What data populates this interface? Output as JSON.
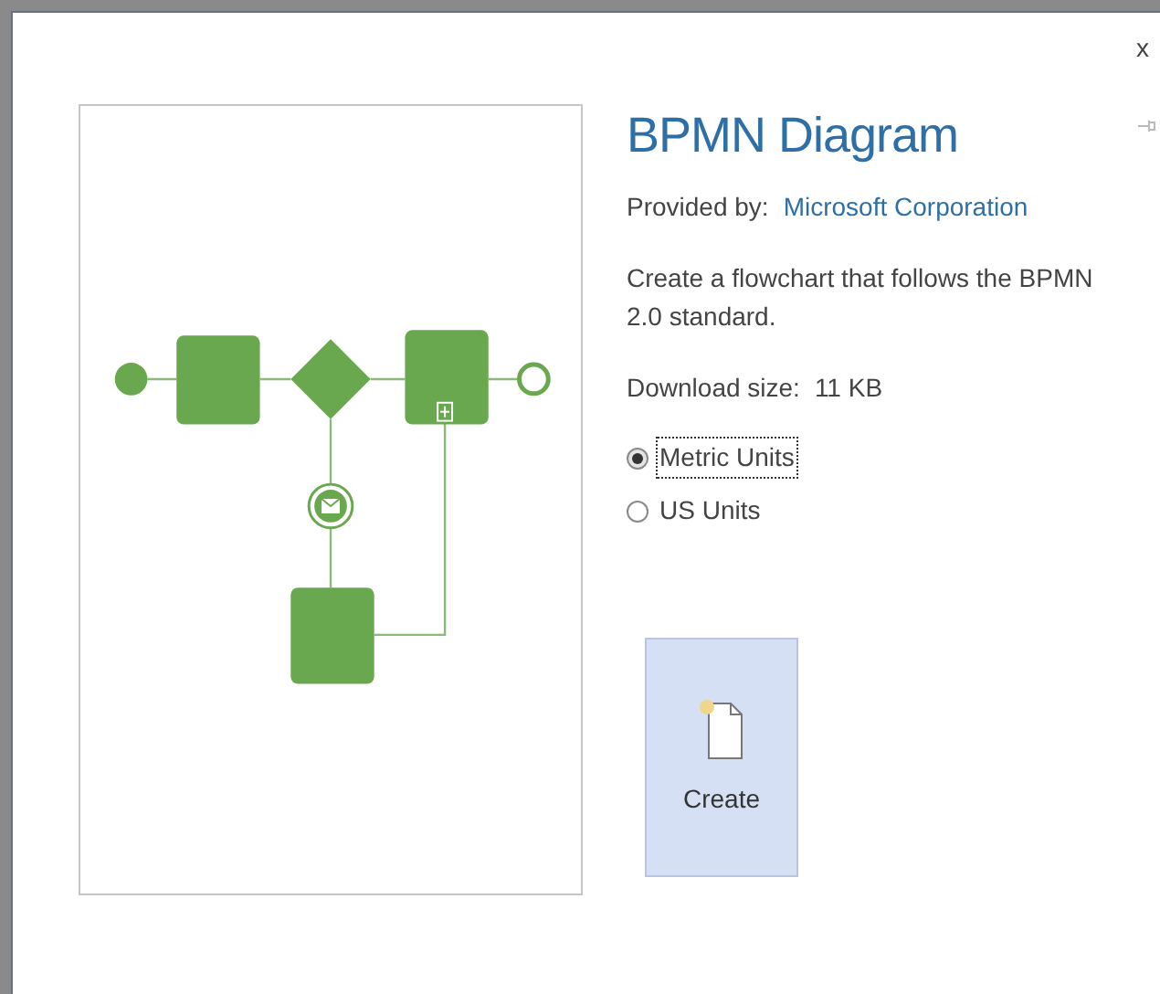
{
  "dialog": {
    "close": "x",
    "title": "BPMN Diagram",
    "provider_label": "Provided by:",
    "provider": "Microsoft Corporation",
    "description": "Create a flowchart that follows the BPMN 2.0 standard.",
    "download_label": "Download size:",
    "download_size": "11 KB",
    "units": [
      {
        "label": "Metric Units",
        "selected": true,
        "focused": true
      },
      {
        "label": "US Units",
        "selected": false,
        "focused": false
      }
    ],
    "create_button": "Create"
  }
}
